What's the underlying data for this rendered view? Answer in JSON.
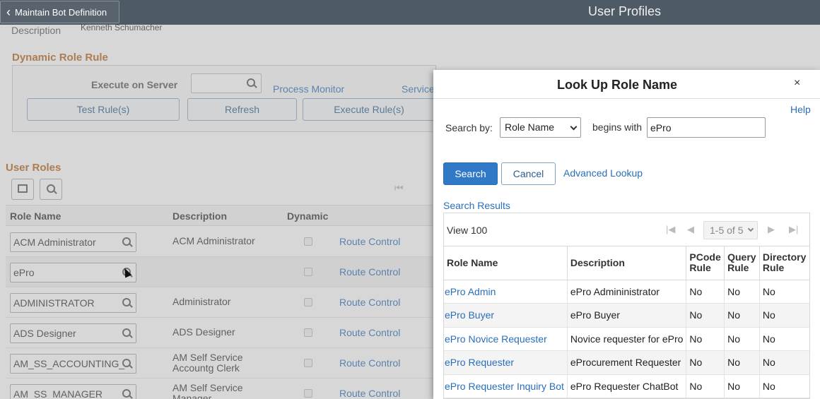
{
  "header": {
    "back_label": "Maintain Bot Definition",
    "title": "User Profiles"
  },
  "background": {
    "description_label": "Description",
    "description_value": "Kenneth Schumacher",
    "dynamic_role_rule_title": "Dynamic Role Rule",
    "execute_on_server_label": "Execute on Server",
    "process_monitor_link": "Process Monitor",
    "service_link": "Service",
    "test_rules_button": "Test Rule(s)",
    "refresh_button": "Refresh",
    "execute_rules_button": "Execute Rule(s)",
    "user_roles_title": "User Roles",
    "columns": [
      "Role Name",
      "Description",
      "Dynamic"
    ],
    "rows": [
      {
        "role": "ACM Administrator",
        "description": "ACM Administrator",
        "link": "Route Control"
      },
      {
        "role": "ePro",
        "description": "",
        "link": "Route Control"
      },
      {
        "role": "ADMINISTRATOR",
        "description": "Administrator",
        "link": "Route Control"
      },
      {
        "role": "ADS Designer",
        "description": "ADS Designer",
        "link": "Route Control"
      },
      {
        "role": "AM_SS_ACCOUNTING_",
        "description": "AM Self Service Accountg Clerk",
        "link": "Route Control"
      },
      {
        "role": "AM_SS_MANAGER",
        "description": "AM Self Service Manager",
        "link": "Route Control"
      }
    ]
  },
  "modal": {
    "title": "Look Up Role Name",
    "close": "×",
    "help": "Help",
    "search_by_label": "Search by:",
    "search_by_value": "Role Name",
    "begins_with_label": "begins with",
    "begins_with_value": "ePro",
    "search_button": "Search",
    "cancel_button": "Cancel",
    "advanced_lookup": "Advanced Lookup",
    "search_results_title": "Search Results",
    "view_100": "View 100",
    "pager": "1-5 of 5",
    "columns": [
      "Role Name",
      "Description",
      "PCode Rule",
      "Query Rule",
      "Directory Rule"
    ],
    "results": [
      {
        "role": "ePro Admin",
        "description": "ePro Admininistrator",
        "pcode": "No",
        "query": "No",
        "directory": "No"
      },
      {
        "role": "ePro Buyer",
        "description": "ePro Buyer",
        "pcode": "No",
        "query": "No",
        "directory": "No"
      },
      {
        "role": "ePro Novice Requester",
        "description": "Novice requester for ePro",
        "pcode": "No",
        "query": "No",
        "directory": "No"
      },
      {
        "role": "ePro Requester",
        "description": "eProcurement Requester",
        "pcode": "No",
        "query": "No",
        "directory": "No"
      },
      {
        "role": "ePro Requester Inquiry Bot",
        "description": "ePro Requester ChatBot",
        "pcode": "No",
        "query": "No",
        "directory": "No"
      }
    ]
  }
}
